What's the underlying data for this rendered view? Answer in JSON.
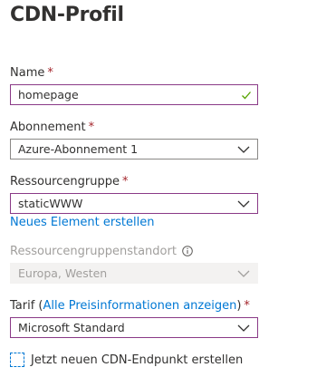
{
  "page": {
    "title": "CDN-Profil"
  },
  "form": {
    "name": {
      "label": "Name",
      "required": "*",
      "value": "homepage",
      "valid_icon": "checkmark-icon"
    },
    "subscription": {
      "label": "Abonnement",
      "required": "*",
      "value": "Azure-Abonnement 1"
    },
    "resource_group": {
      "label": "Ressourcengruppe",
      "required": "*",
      "value": "staticWWW",
      "create_link": "Neues Element erstellen"
    },
    "resource_group_location": {
      "label": "Ressourcengruppenstandort",
      "value": "Europa, Westen",
      "info_icon": "info-icon",
      "disabled": true
    },
    "pricing_tier": {
      "label_prefix": "Tarif (",
      "link": "Alle Preisinformationen anzeigen",
      "label_suffix": ")",
      "required": "*",
      "value": "Microsoft Standard"
    },
    "create_endpoint": {
      "label": "Jetzt neuen CDN-Endpunkt erstellen",
      "checked": false
    }
  },
  "colors": {
    "accent": "#0078d4",
    "required": "#a4262c",
    "focus_border": "#8a3a87",
    "valid": "#57a300",
    "disabled_bg": "#f3f2f1",
    "disabled_text": "#a19f9d"
  }
}
